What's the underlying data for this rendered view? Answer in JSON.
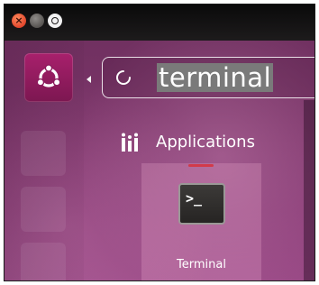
{
  "window": {
    "close_glyph": "×",
    "close_color": "#e0462c",
    "minimize_color": "#575451"
  },
  "launcher": {
    "dash_icon": "ubuntu-logo-icon",
    "dash_color": "#a8206c"
  },
  "search": {
    "query": "terminal",
    "status_icon": "spinner-icon"
  },
  "category": {
    "icon": "applications-icon",
    "label": "Applications"
  },
  "results": [
    {
      "icon": "terminal-icon",
      "prompt": ">_",
      "label": "Terminal"
    }
  ],
  "colors": {
    "dash_background": "#7a3468",
    "selection_highlight": "#7a7a7a"
  }
}
